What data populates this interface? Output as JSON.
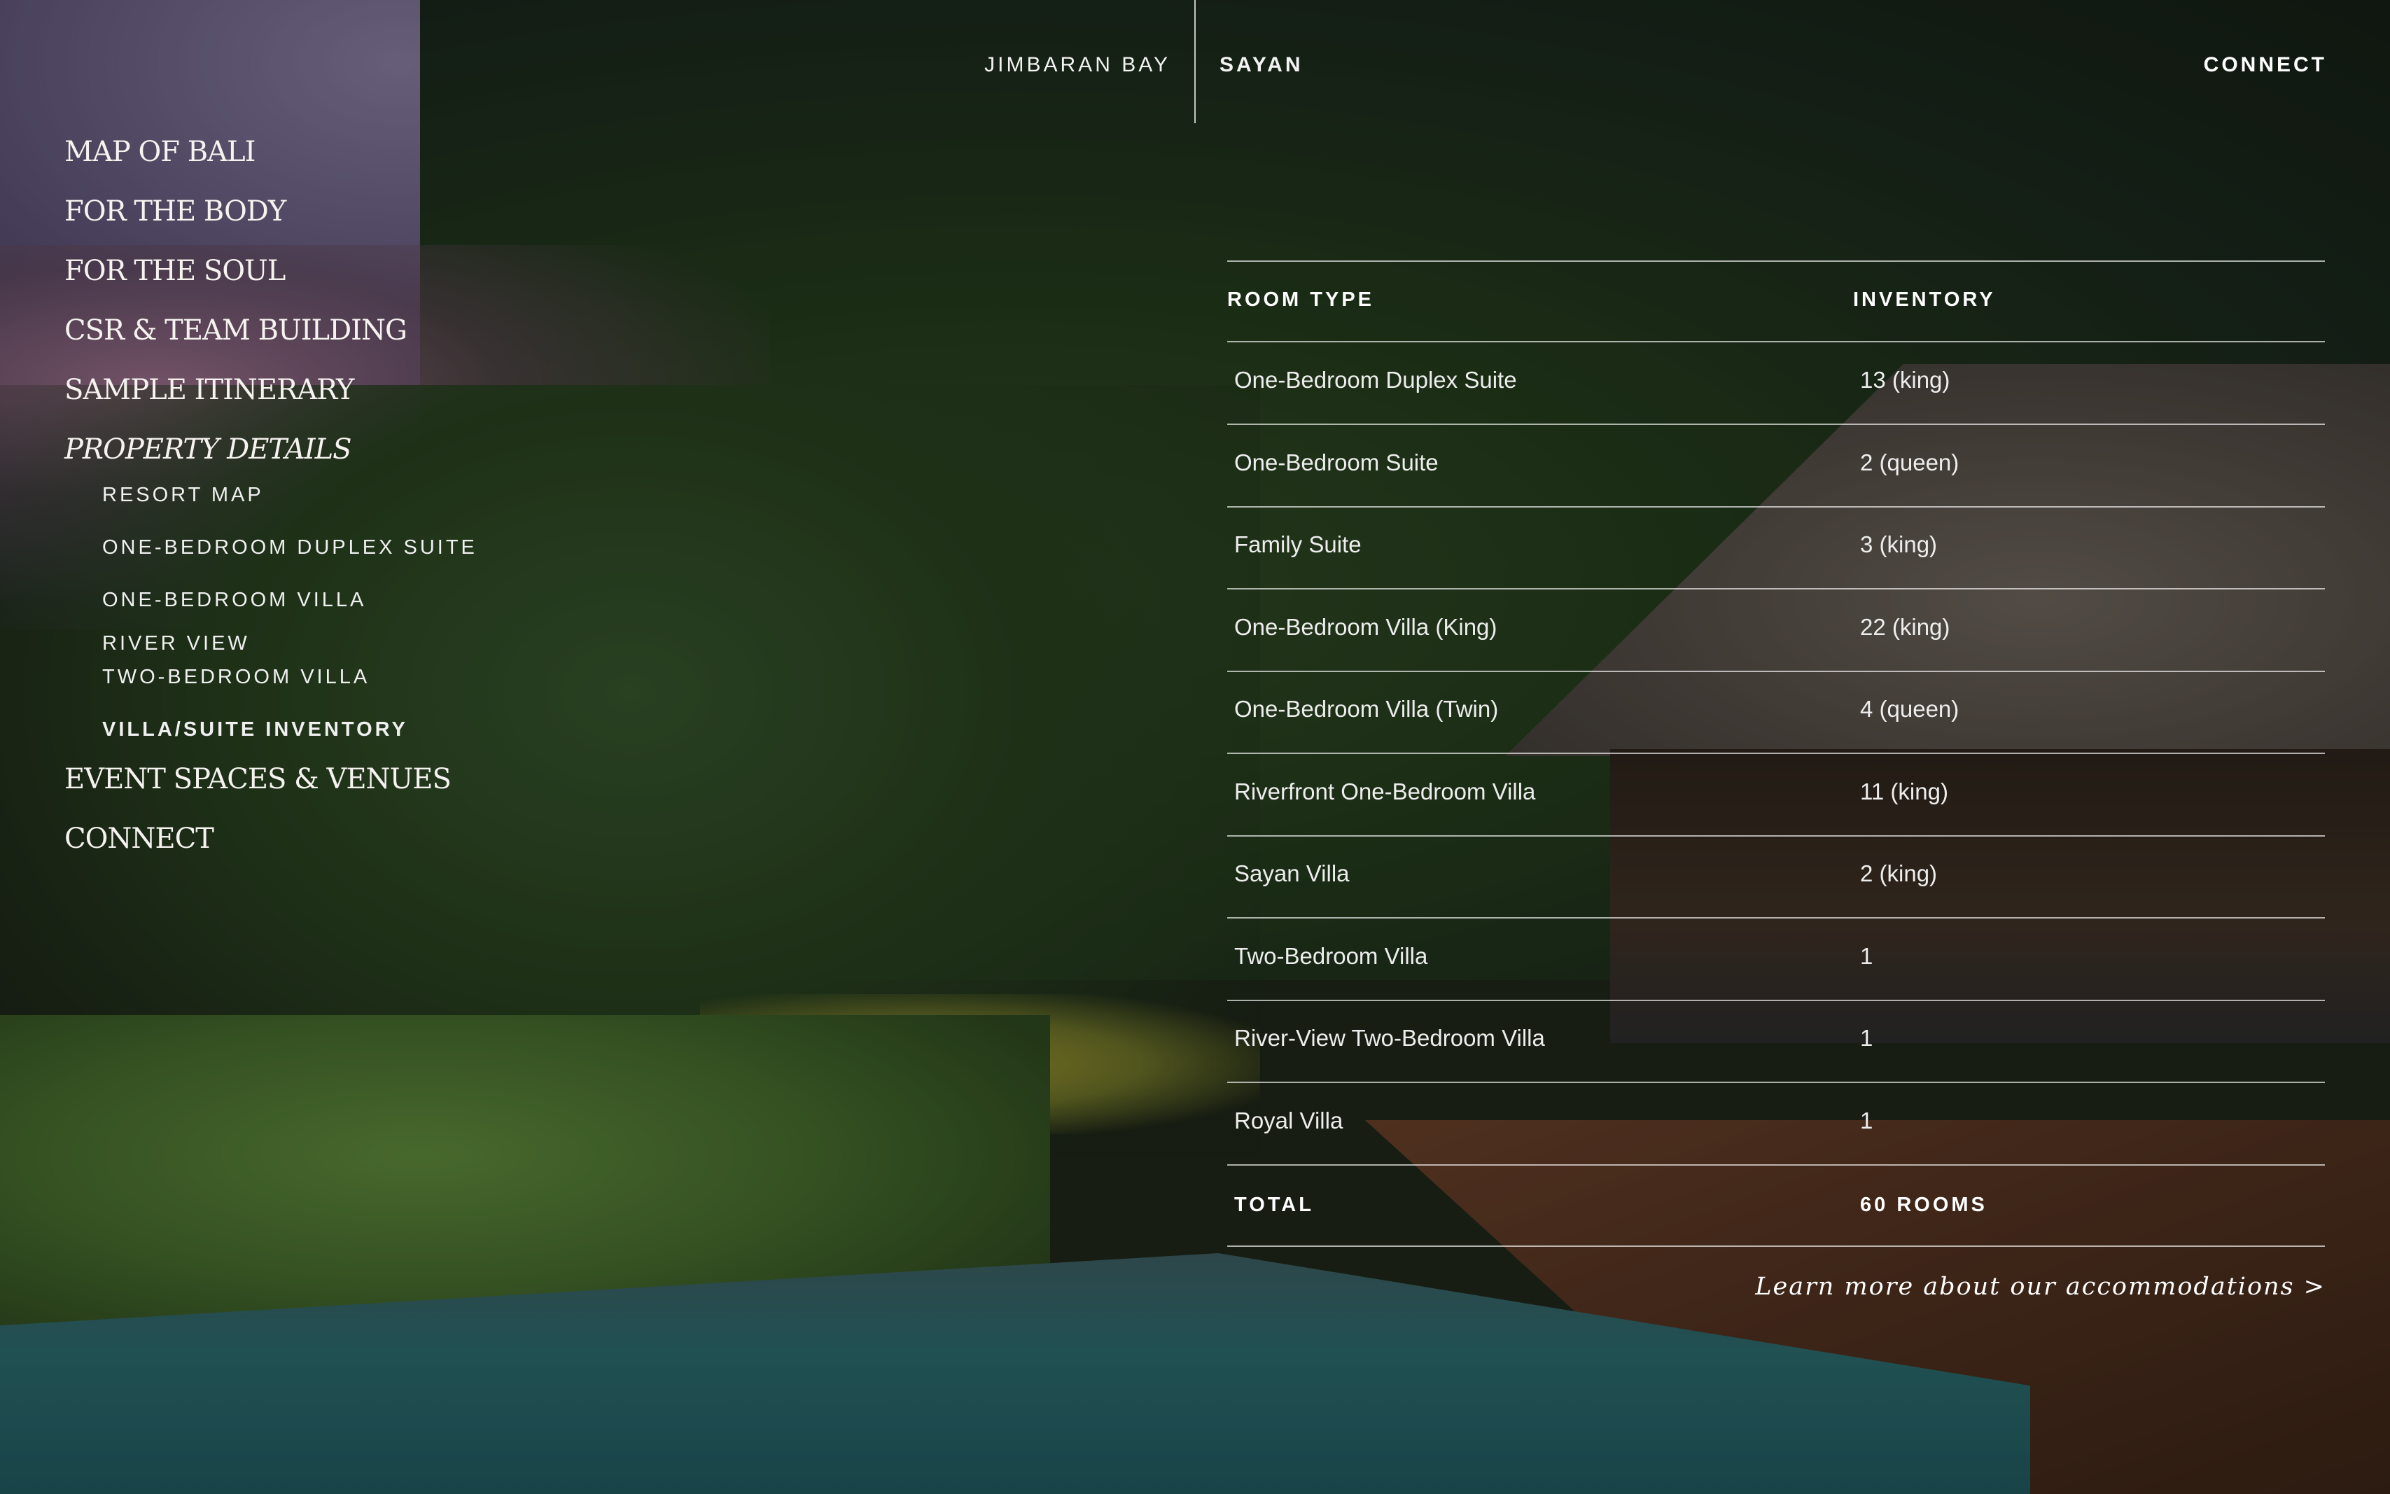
{
  "topnav": {
    "locations": [
      "JIMBARAN BAY",
      "SAYAN"
    ],
    "active": "SAYAN",
    "connect": "CONNECT"
  },
  "sidebar": {
    "items": [
      {
        "label": "MAP OF BALI"
      },
      {
        "label": "FOR THE BODY"
      },
      {
        "label": "FOR THE SOUL"
      },
      {
        "label": "CSR & TEAM BUILDING"
      },
      {
        "label": "SAMPLE ITINERARY"
      },
      {
        "label": "PROPERTY DETAILS"
      },
      {
        "label": "EVENT SPACES & VENUES"
      },
      {
        "label": "CONNECT"
      }
    ],
    "subitems": [
      {
        "label": "RESORT MAP"
      },
      {
        "label": "ONE-BEDROOM DUPLEX SUITE"
      },
      {
        "label": "ONE-BEDROOM VILLA"
      },
      {
        "label": "RIVER VIEW"
      },
      {
        "label": "TWO-BEDROOM VILLA"
      },
      {
        "label": "VILLA/SUITE INVENTORY"
      }
    ]
  },
  "table": {
    "headers": {
      "room_type": "ROOM TYPE",
      "inventory": "INVENTORY"
    },
    "rows": [
      {
        "room": "One-Bedroom Duplex Suite",
        "inventory": "13 (king)"
      },
      {
        "room": "One-Bedroom Suite",
        "inventory": "2 (queen)"
      },
      {
        "room": "Family Suite",
        "inventory": "3 (king)"
      },
      {
        "room": "One-Bedroom Villa (King)",
        "inventory": "22 (king)"
      },
      {
        "room": "One-Bedroom Villa (Twin)",
        "inventory": "4 (queen)"
      },
      {
        "room": "Riverfront One-Bedroom Villa",
        "inventory": "11 (king)"
      },
      {
        "room": "Sayan Villa",
        "inventory": "2 (king)"
      },
      {
        "room": "Two-Bedroom Villa",
        "inventory": "1"
      },
      {
        "room": "River-View Two-Bedroom Villa",
        "inventory": "1"
      },
      {
        "room": "Royal Villa",
        "inventory": "1"
      }
    ],
    "total": {
      "label": "TOTAL",
      "value": "60 ROOMS"
    }
  },
  "learn_more": "Learn more about our accommodations >"
}
